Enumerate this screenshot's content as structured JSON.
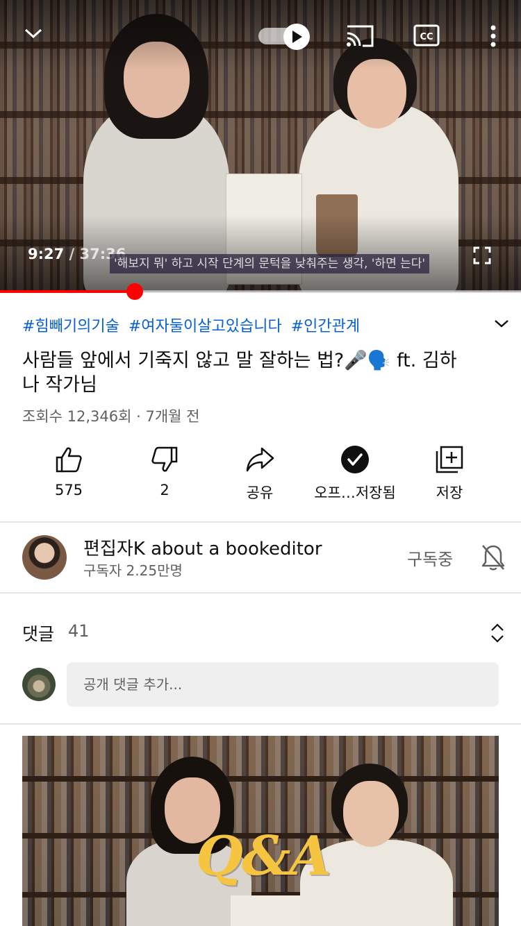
{
  "player": {
    "current_time": "9:27",
    "duration": "/ 37:36",
    "caption": "'해보지 뭐' 하고 시작 단계의 문턱을 낮춰주는 생각, '하면 는다'",
    "progress_fraction": 0.258,
    "icons": [
      "chevron-down-icon",
      "autoplay-toggle-icon",
      "cast-icon",
      "closed-captions-icon",
      "more-vert-icon",
      "fullscreen-icon"
    ]
  },
  "video": {
    "hashtags": [
      "#힘빼기의기술",
      "#여자둘이살고있습니다",
      "#인간관계"
    ],
    "title": "사람들 앞에서 기죽지 않고 말 잘하는 법?🎤🗣️  ft. 김하나 작가님",
    "meta": "조회수 12,346회 · 7개월 전"
  },
  "actions": {
    "like": "575",
    "dislike": "2",
    "share": "공유",
    "offline": "오프…저장됨",
    "save": "저장"
  },
  "channel": {
    "name": "편집자K about a bookeditor",
    "subscribers": "구독자 2.25만명",
    "subscribed_label": "구독중"
  },
  "comments": {
    "title": "댓글",
    "count": "41",
    "placeholder": "공개 댓글 추가..."
  },
  "next_video": {
    "overlay_text": "Q&A"
  },
  "colors": {
    "accent_red": "#ff0000",
    "link_blue": "#065fd4",
    "secondary_text": "#606060"
  }
}
